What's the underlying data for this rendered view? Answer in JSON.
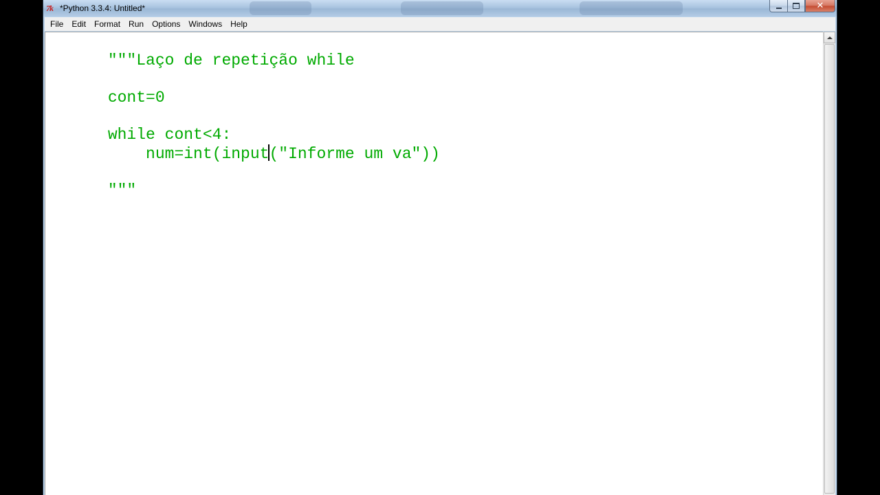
{
  "window": {
    "title": "*Python 3.3.4: Untitled*",
    "icon": "tk-feather-icon"
  },
  "menu": {
    "items": [
      "File",
      "Edit",
      "Format",
      "Run",
      "Options",
      "Windows",
      "Help"
    ]
  },
  "editor": {
    "lines": [
      "\"\"\"Laço de repetição while",
      "",
      "cont=0",
      "",
      "while cont<4:",
      "    num=int(input(\"Informe um va\"))",
      "",
      "\"\"\""
    ],
    "cursor": {
      "line": 6,
      "column": 17
    },
    "string_color": "#00aa00"
  }
}
